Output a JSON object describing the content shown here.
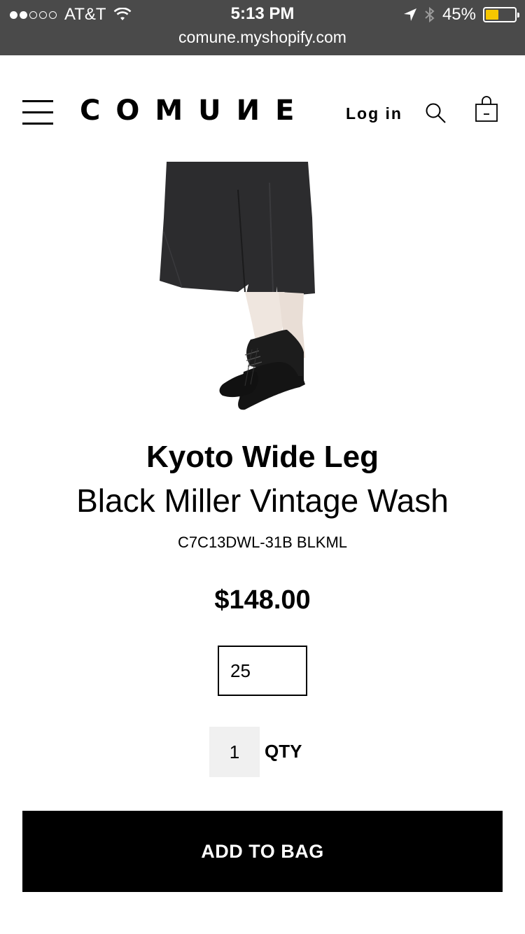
{
  "status_bar": {
    "carrier": "AT&T",
    "time": "5:13 PM",
    "battery_percent": "45%",
    "battery_level": 0.45,
    "battery_color": "#f6c700",
    "url": "comune.myshopify.com",
    "signal_icons": [
      "signal-dots-icon",
      "wifi-icon",
      "location-arrow-icon",
      "bluetooth-icon",
      "battery-icon"
    ]
  },
  "header": {
    "logo": "COMUИE",
    "login_label": "Log in",
    "icons": [
      "hamburger-menu-icon",
      "search-icon",
      "shopping-bag-icon"
    ]
  },
  "product": {
    "title": "Kyoto Wide Leg",
    "subtitle": "Black Miller Vintage Wash",
    "sku": "C7C13DWL-31B BLKML",
    "price": "$148.00",
    "size_selected": "25",
    "quantity": "1",
    "qty_label": "QTY",
    "add_button_label": "ADD TO BAG"
  }
}
